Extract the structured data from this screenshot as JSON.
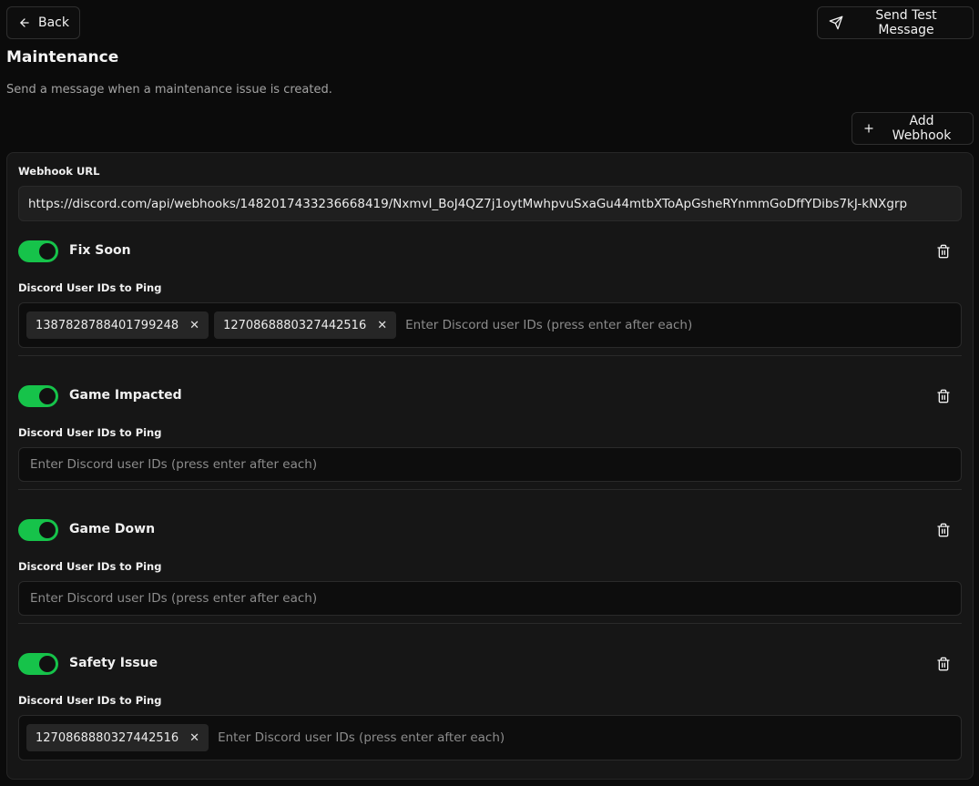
{
  "header": {
    "back_label": "Back",
    "send_test_label": "Send Test Message",
    "title": "Maintenance",
    "subtitle": "Send a message when a maintenance issue is created.",
    "add_webhook_label": "Add Webhook"
  },
  "webhook": {
    "url_label": "Webhook URL",
    "url": "https://discord.com/api/webhooks/1482017433236668419/NxmvI_BoJ4QZ7j1oytMwhpvuSxaGu44mtbXToApGsheRYnmmGoDffYDibs7kJ-kNXgrp",
    "ping_label": "Discord User IDs to Ping",
    "ping_placeholder": "Enter Discord user IDs (press enter after each)",
    "categories": [
      {
        "name": "Fix Soon",
        "enabled": true,
        "user_ids": [
          "1387828788401799248",
          "1270868880327442516"
        ]
      },
      {
        "name": "Game Impacted",
        "enabled": true,
        "user_ids": []
      },
      {
        "name": "Game Down",
        "enabled": true,
        "user_ids": []
      },
      {
        "name": "Safety Issue",
        "enabled": true,
        "user_ids": [
          "1270868880327442516"
        ]
      }
    ]
  },
  "colors": {
    "toggle_on": "#16c34a",
    "background": "#0b0b0b",
    "card": "#161616"
  },
  "icons": {
    "back": "arrow-left-icon",
    "send": "send-icon",
    "add": "plus-icon",
    "delete": "trash-icon",
    "remove_tag": "x-icon"
  }
}
